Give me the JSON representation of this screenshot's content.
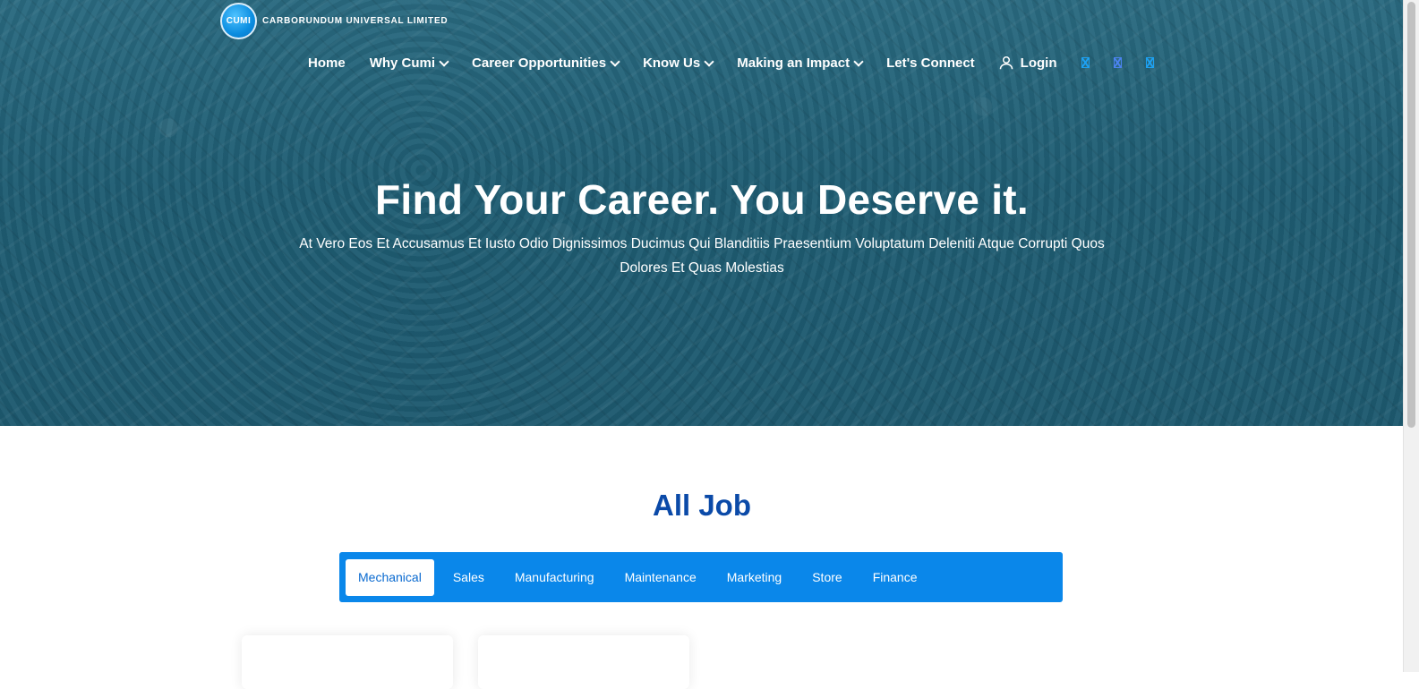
{
  "brand": {
    "badge": "CUMI",
    "name": "CARBORUNDUM UNIVERSAL LIMITED"
  },
  "nav": {
    "items": [
      {
        "label": "Home",
        "dropdown": false
      },
      {
        "label": "Why Cumi",
        "dropdown": true
      },
      {
        "label": "Career Opportunities",
        "dropdown": true
      },
      {
        "label": "Know Us",
        "dropdown": true
      },
      {
        "label": "Making an Impact",
        "dropdown": true
      },
      {
        "label": "Let's Connect",
        "dropdown": false
      }
    ],
    "login": "Login",
    "social_icons": [
      "social-icon",
      "social-icon",
      "social-icon"
    ]
  },
  "hero": {
    "title": "Find Your Career. You Deserve it.",
    "subtitle_line1": "At Vero Eos Et Accusamus Et Iusto Odio Dignissimos Ducimus Qui Blanditiis Praesentium Voluptatum Deleniti Atque Corrupti Quos",
    "subtitle_line2": "Dolores Et Quas Molestias"
  },
  "jobs": {
    "title": "All Job",
    "tabs": [
      "Mechanical",
      "Sales",
      "Manufacturing",
      "Maintenance",
      "Marketing",
      "Store",
      "Finance"
    ],
    "active_tab": "Mechanical"
  },
  "colors": {
    "hero_overlay": "#1f5d73",
    "accent": "#0a87ea",
    "title": "#0b4aa8"
  }
}
